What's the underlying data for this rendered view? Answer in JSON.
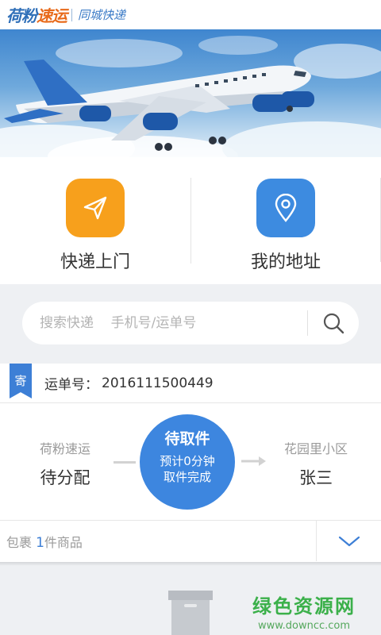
{
  "header": {
    "logo_main": "荷粉",
    "logo_accent": "速运",
    "slogan": "同城快递"
  },
  "actions": [
    {
      "label": "快递上门",
      "icon": "paper-plane-icon",
      "color": "#f7a01c"
    },
    {
      "label": "我的地址",
      "icon": "location-pin-icon",
      "color": "#3d8be0"
    }
  ],
  "search": {
    "placeholder": "搜索快递    手机号/运单号",
    "value": "",
    "icon": "search-icon"
  },
  "shipment": {
    "tag": "寄",
    "waybill_label": "运单号：",
    "waybill_number": "2016111500449",
    "sender_name": "荷粉速运",
    "sender_status": "待分配",
    "status_title": "待取件",
    "status_line1": "预计0分钟",
    "status_line2": "取件完成",
    "receiver_place": "花园里小区",
    "receiver_name": "张三",
    "package_prefix": "包裹 ",
    "package_count": "1",
    "package_suffix": "件商品"
  },
  "watermark": {
    "title": "绿色资源网",
    "url": "www.downcc.com"
  },
  "colors": {
    "brand_blue": "#3d86df",
    "brand_orange": "#f7a01c",
    "watermark_green": "#3bb04a"
  }
}
